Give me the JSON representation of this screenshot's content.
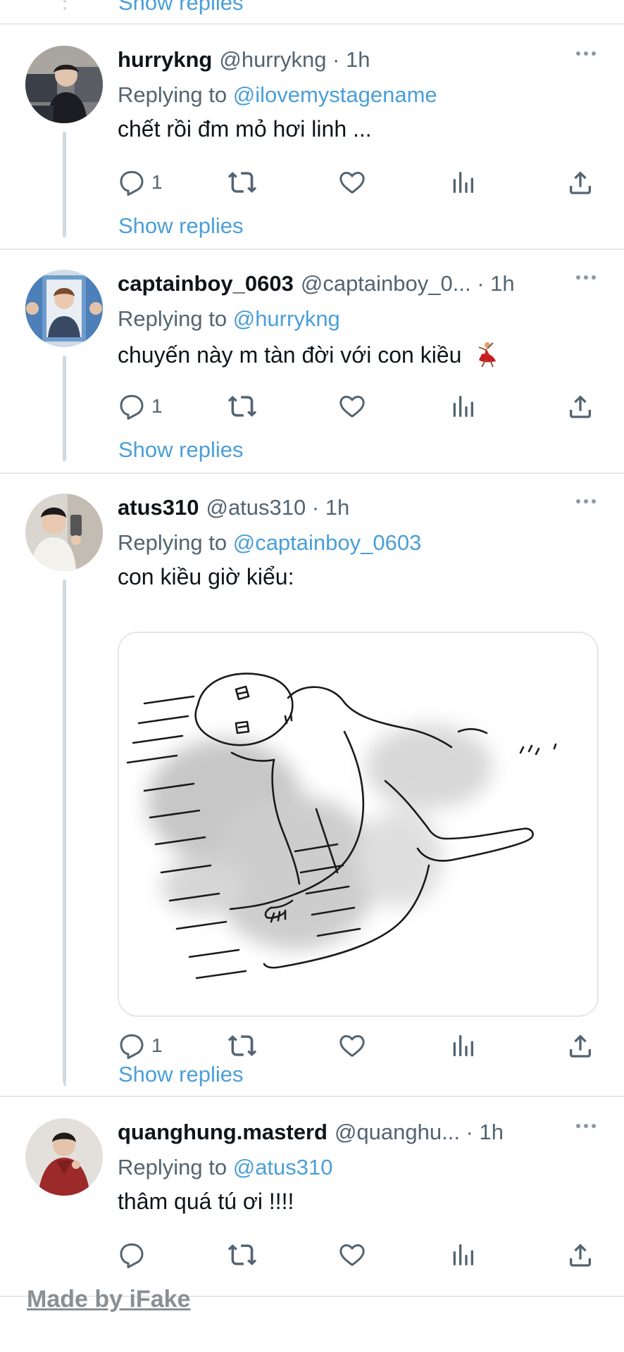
{
  "top": {
    "show_replies": "Show replies"
  },
  "tweets": [
    {
      "name": "hurrykng",
      "handle": "@hurrykng · 1h",
      "replying_prefix": "Replying to",
      "replying_to": "@ilovemystagename",
      "text": "chết rồi đm mỏ hơi linh ...",
      "reply_count": "1",
      "show_replies": "Show replies"
    },
    {
      "name": "captainboy_0603",
      "handle": "@captainboy_0... · 1h",
      "replying_prefix": "Replying to",
      "replying_to": "@hurrykng",
      "text": "chuyến này m tàn đời với con kiều",
      "reply_count": "1",
      "show_replies": "Show replies"
    },
    {
      "name": "atus310",
      "handle": "@atus310 · 1h",
      "replying_prefix": "Replying to",
      "replying_to": "@captainboy_0603",
      "text": "con kiều giờ kiểu:",
      "reply_count": "1",
      "show_replies": "Show replies"
    },
    {
      "name": "quanghung.masterd",
      "handle": "@quanghu... · 1h",
      "replying_prefix": "Replying to",
      "replying_to": "@atus310",
      "text": "thâm quá tú ơi !!!!",
      "reply_count": ""
    }
  ],
  "watermark": "Made by iFake",
  "colors": {
    "link": "#4a9fd8",
    "muted": "#536471",
    "divider": "#e6e9ec",
    "thread": "#cfd9de"
  },
  "icons": [
    "reply-icon",
    "retweet-icon",
    "like-icon",
    "views-icon",
    "share-icon",
    "more-icon",
    "dancer-emoji-icon"
  ]
}
